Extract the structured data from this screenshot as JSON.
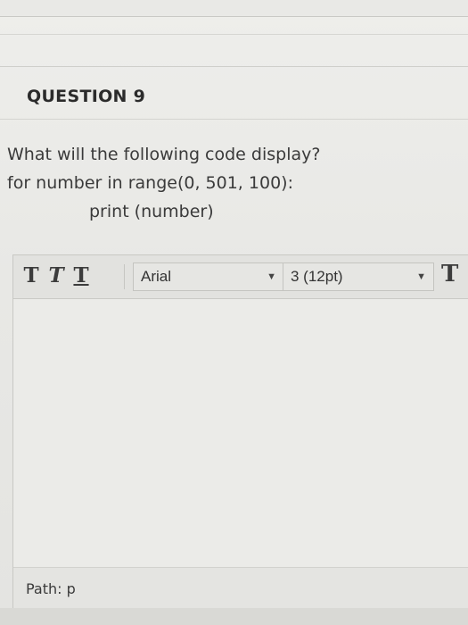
{
  "question": {
    "heading": "QUESTION 9",
    "prompt": "What will the following code display?",
    "code_line_1": "for number in range(0, 501, 100):",
    "code_line_2": "print (number)"
  },
  "editor": {
    "toolbar": {
      "bold_glyph": "T",
      "italic_glyph": "T",
      "underline_glyph": "T",
      "font_family_value": "Arial",
      "font_size_value": "3 (12pt)",
      "text_color_glyph": "T",
      "dropdown_arrow": "▼"
    },
    "body_text": "",
    "status": {
      "path_label": "Path: p"
    }
  }
}
